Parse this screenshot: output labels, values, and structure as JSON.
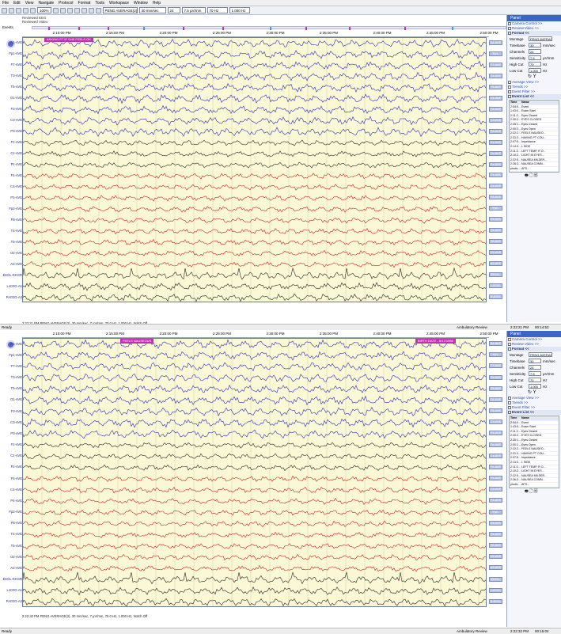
{
  "menu": [
    "File",
    "Edit",
    "View",
    "Navigate",
    "Protocol",
    "Format",
    "Tools",
    "Workspace",
    "Window",
    "Help"
  ],
  "toolbar": {
    "zoom": "100%",
    "montage": "PENG AVERAGE(2)",
    "timebase": "30 mm/sec",
    "channels": "24",
    "sensitivity": "7.5 µV/mm",
    "highcut": "70 Hz",
    "lowcut": "1.000 Hz"
  },
  "video": {
    "line1": "Reviewed EEG",
    "line2": "Reviewed Video"
  },
  "events_label": "Events",
  "colors": {
    "blue": "#2a2ab8",
    "black": "#222222",
    "red": "#cc2222",
    "annot": "#c12fb3",
    "paper": "#fbf8d6"
  },
  "channels": [
    {
      "label": "A1-AVE",
      "color": "blue"
    },
    {
      "label": "Fp1-AVE",
      "color": "blue"
    },
    {
      "label": "F7-AVE",
      "color": "blue"
    },
    {
      "label": "T3-AVE",
      "color": "blue"
    },
    {
      "label": "T5-AVE",
      "color": "blue"
    },
    {
      "label": "O1-AVE",
      "color": "blue"
    },
    {
      "label": "F3-AVE",
      "color": "blue"
    },
    {
      "label": "C3-AVE",
      "color": "blue"
    },
    {
      "label": "P3-AVE",
      "color": "blue"
    },
    {
      "label": "Fz-AVE",
      "color": "black"
    },
    {
      "label": "Cz-AVE",
      "color": "black"
    },
    {
      "label": "Pz-AVE",
      "color": "black"
    },
    {
      "label": "F4-AVE",
      "color": "red"
    },
    {
      "label": "C4-AVE",
      "color": "red"
    },
    {
      "label": "P4-AVE",
      "color": "red"
    },
    {
      "label": "Fp2-AVE",
      "color": "red"
    },
    {
      "label": "F8-AVE",
      "color": "red"
    },
    {
      "label": "T4-AVE",
      "color": "red"
    },
    {
      "label": "T6-AVE",
      "color": "red"
    },
    {
      "label": "O2-AVE",
      "color": "red"
    },
    {
      "label": "A2-AVE",
      "color": "red"
    },
    {
      "label": "EKGL-EKGR",
      "color": "black"
    },
    {
      "label": "L-EOG-A1",
      "color": "black"
    },
    {
      "label": "R-EOG-A2",
      "color": "black"
    }
  ],
  "pane1": {
    "times": [
      "2:10:00 PM",
      "2:15:00 PM",
      "2:20:00 PM",
      "2:25:00 PM",
      "2:30:00 PM",
      "2:35:00 PM",
      "2:40:00 PM",
      "2:45:00 PM",
      "2:50:00 PM"
    ],
    "annotations": [
      {
        "text": "ASKING PT IF SHE FEELS OK"
      }
    ],
    "status": "2:22:21 PM PENG AVERAGE(2), 30 mm/sec, 7 µV/mm, 70.0 Hz, 1.000 Hz, Notch Off",
    "clock": "2:22:21 PM",
    "elapsed": "00:14:53"
  },
  "pane2": {
    "times": [
      "2:10:00 PM",
      "2:15:00 PM",
      "2:20:00 PM",
      "2:25:00 PM",
      "2:30:00 PM",
      "2:35:00 PM",
      "2:40:00 PM",
      "2:45:00 PM",
      "2:50:00 PM"
    ],
    "annotations": [
      {
        "text": "FEELS NAUSEOUS"
      },
      {
        "text": "BIRTH DATE - 6/17/1998"
      }
    ],
    "status": "2:22:32 PM PENG AVERAGE(2), 30 mm/sec, 7 µV/mm, 70.0 Hz, 1.000 Hz, Notch Off",
    "clock": "2:22:32 PM",
    "elapsed": "00:15:04"
  },
  "panel": {
    "title": "Panel",
    "sections": [
      "Camera Control >>",
      "Review Video >>"
    ],
    "format_title": "Format <<",
    "format": {
      "montage_label": "Montage",
      "montage": "PENG AVERAG",
      "timebase_label": "Timebase",
      "timebase": "30",
      "timebase_unit": "mm/sec",
      "channels_label": "Channels",
      "channels": "24",
      "sensitivity_label": "Sensitivity",
      "sensitivity": "7.5",
      "sensitivity_unit": "µV/mm",
      "highcut_label": "High Cut",
      "highcut": "70",
      "highcut_unit": "Hz",
      "lowcut_label": "Low Cut",
      "lowcut": "1.000",
      "lowcut_unit": "Hz"
    },
    "sections2": [
      "Average View >>",
      "Trends >>",
      "Event Filter >>"
    ],
    "eventlist_title": "Event List <<",
    "eventlist_header": {
      "time": "Time",
      "name": "Name"
    },
    "events": [
      {
        "time": "2:54:0...",
        "name": "Event"
      },
      {
        "time": "1:43:0...",
        "name": "Exam Start"
      },
      {
        "time": "2:11:2...",
        "name": "Eyes Closed"
      },
      {
        "time": "2:30:2...",
        "name": "EYES CLOSED"
      },
      {
        "time": "2:35:1...",
        "name": "Eyes Closed"
      },
      {
        "time": "2:00:2...",
        "name": "Eyes Open"
      },
      {
        "time": "2:22:2...",
        "name": "FEELS NAUSEO..."
      },
      {
        "time": "2:31:3...",
        "name": "HAVING PT COU..."
      },
      {
        "time": "2:07:5...",
        "name": "Impedance"
      },
      {
        "time": "2:14:3...",
        "name": "L SIDE"
      },
      {
        "time": "2:11:2...",
        "name": "LEFT TEMP, R O..."
      },
      {
        "time": "2:10:2...",
        "name": "LIGHT IN EYES..."
      },
      {
        "time": "2:22:5...",
        "name": "NAUSEA MILDER..."
      },
      {
        "time": "2:26:3...",
        "name": "NAUSEA COMN..."
      },
      {
        "time": "photic...",
        "name": "AFS..."
      }
    ]
  },
  "statusbar": {
    "ready": "Ready",
    "review": "Ambulatory Review"
  }
}
